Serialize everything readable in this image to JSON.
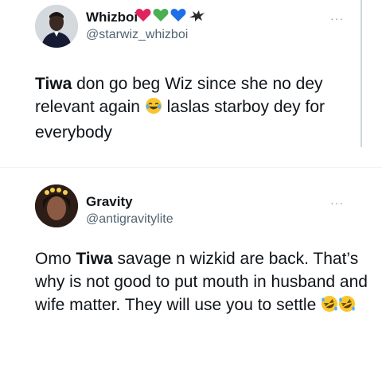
{
  "tweets": [
    {
      "name": "Whizboi",
      "handle": "@starwiz_whizboi",
      "badges": [
        "red-heart-icon",
        "green-heart-icon",
        "blue-heart-icon",
        "crow-icon"
      ],
      "more": "···",
      "segments": [
        {
          "text": "Tiwa",
          "bold": true
        },
        {
          "text": " don go beg Wiz since she no dey relevant again ",
          "bold": false
        },
        {
          "emoji": "tears-of-joy-emoji"
        },
        {
          "text": " laslas starboy dey for everybody",
          "bold": false
        }
      ]
    },
    {
      "name": "Gravity",
      "handle": "@antigravitylite",
      "more": "···",
      "segments": [
        {
          "text": "Omo ",
          "bold": false
        },
        {
          "text": "Tiwa",
          "bold": true
        },
        {
          "text": " savage n wizkid are back. That’s why is not good to put mouth in husband and wife matter. They will use you to settle ",
          "bold": false
        },
        {
          "emoji": "rolling-on-floor-laughing-emoji"
        },
        {
          "emoji": "rolling-on-floor-laughing-emoji"
        }
      ]
    }
  ],
  "colors": {
    "text": "#0f1419",
    "muted": "#536471",
    "heart_red": "#e0245e",
    "heart_green": "#4caf50",
    "heart_blue": "#1d6ee8",
    "emoji_yellow": "#f7c62f"
  }
}
